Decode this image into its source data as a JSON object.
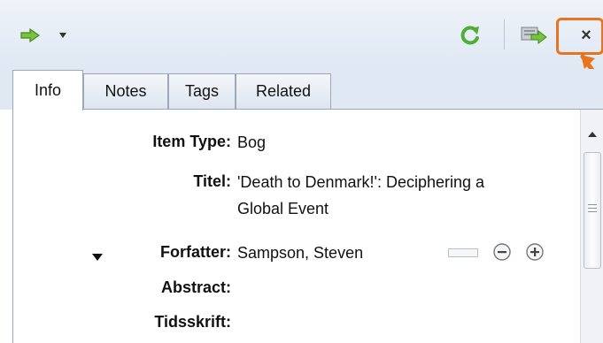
{
  "toolbar": {
    "icons": [
      "green-arrow-icon",
      "dropdown-arrow-icon",
      "refresh-icon",
      "add-to-collection-icon",
      "close-icon"
    ],
    "close_glyph": "×",
    "highlight_color": "#e8741f"
  },
  "tabs": [
    {
      "label": "Info"
    },
    {
      "label": "Notes"
    },
    {
      "label": "Tags"
    },
    {
      "label": "Related"
    }
  ],
  "fields": {
    "item_type": {
      "label": "Item Type:",
      "value": "Bog"
    },
    "title": {
      "label": "Titel:",
      "value_line1": "'Death to Denmark!': Deciphering a",
      "value_line2": "Global Event"
    },
    "author": {
      "label": "Forfatter:",
      "value": "Sampson, Steven"
    },
    "abstract": {
      "label": "Abstract:"
    },
    "journal": {
      "label": "Tidsskrift:"
    }
  }
}
